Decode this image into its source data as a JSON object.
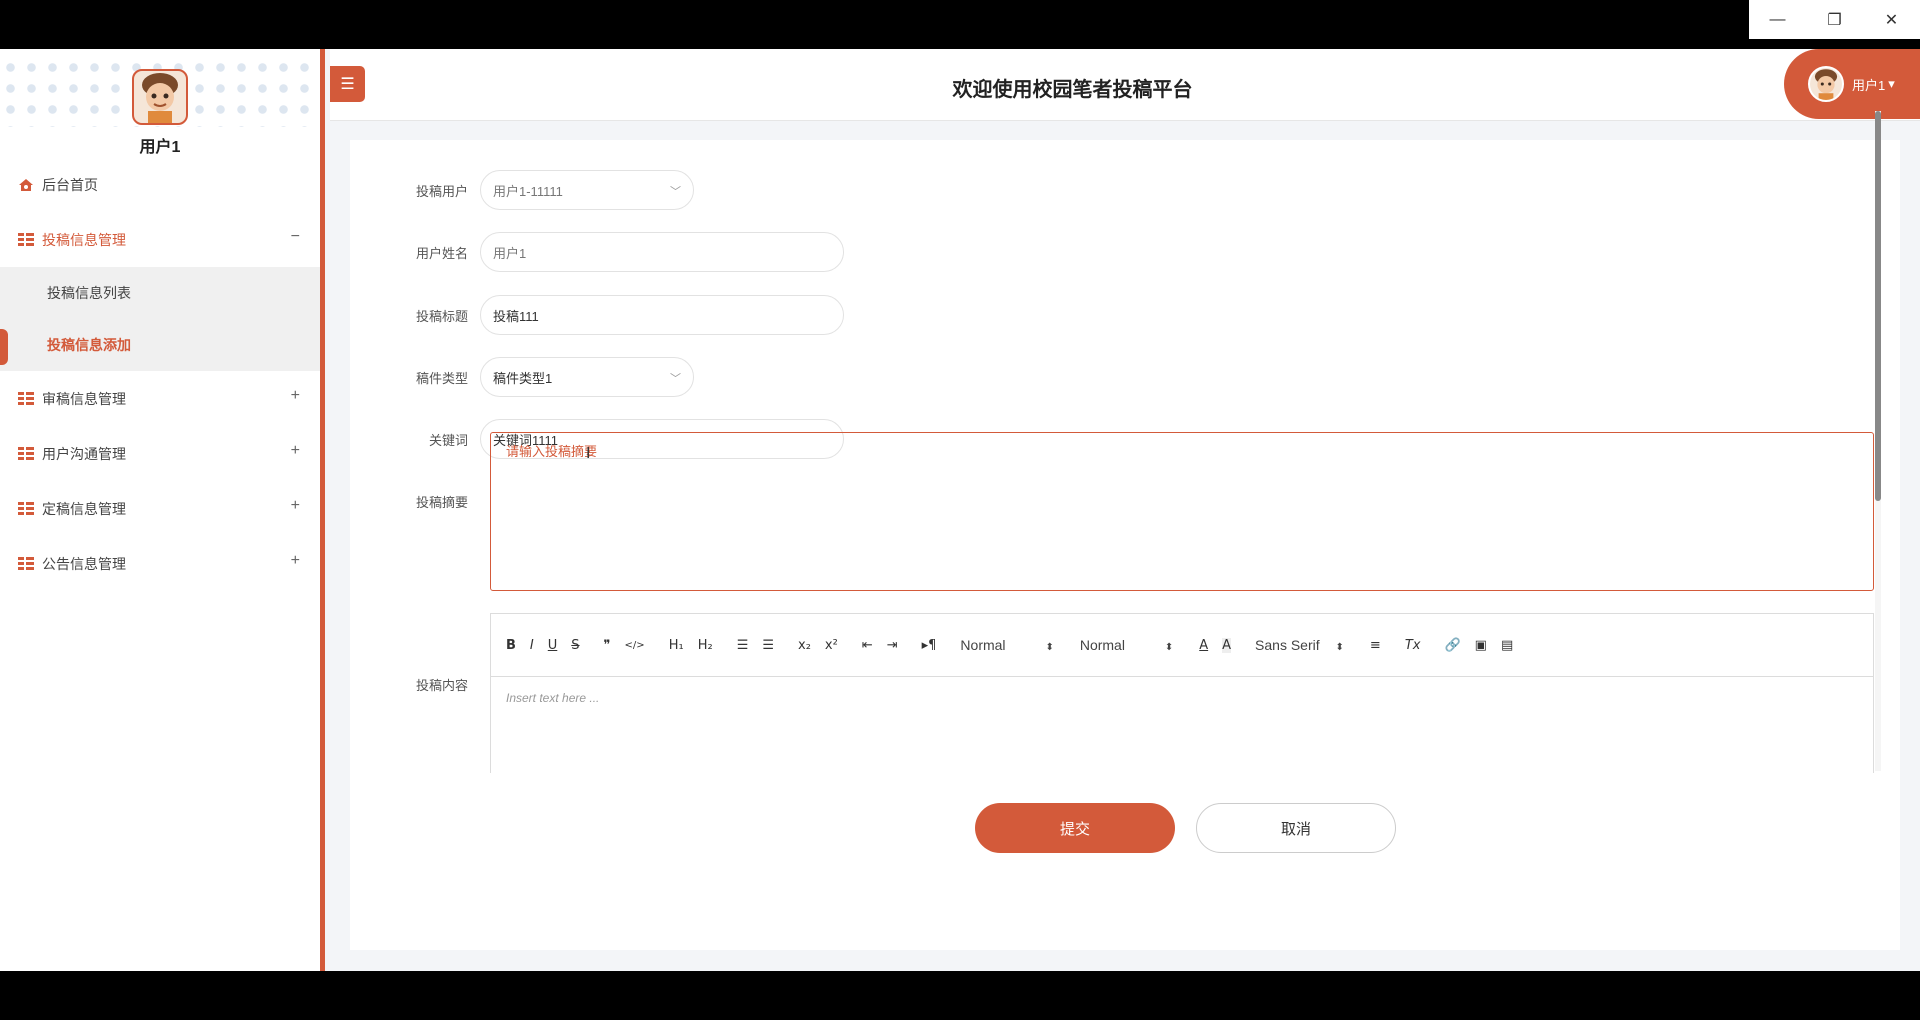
{
  "sidebar": {
    "username": "用户1",
    "items": [
      {
        "label": "后台首页"
      },
      {
        "label": "投稿信息管理",
        "toggle": "−"
      },
      {
        "label": "审稿信息管理",
        "toggle": "+"
      },
      {
        "label": "用户沟通管理",
        "toggle": "+"
      },
      {
        "label": "定稿信息管理",
        "toggle": "+"
      },
      {
        "label": "公告信息管理",
        "toggle": "+"
      }
    ],
    "submenu": [
      {
        "label": "投稿信息列表"
      },
      {
        "label": "投稿信息添加"
      }
    ]
  },
  "header": {
    "menu_icon": "☰",
    "title": "欢迎使用校园笔者投稿平台",
    "user": "用户1",
    "user_caret": "▾"
  },
  "form": {
    "fields": [
      {
        "label": "投稿用户",
        "value": "用户1-11111"
      },
      {
        "label": "用户姓名",
        "value": "用户1"
      },
      {
        "label": "投稿标题",
        "value": "投稿111"
      },
      {
        "label": "稿件类型",
        "value": "稿件类型1"
      },
      {
        "label": "关键词",
        "value": "关键词1111"
      }
    ],
    "abstract_label": "投稿摘要",
    "abstract_placeholder": "请输入投稿摘要",
    "content_label": "投稿内容",
    "editor_placeholder": "Insert text here ...",
    "toolbar": {
      "bold": "B",
      "italic": "I",
      "underline": "U",
      "strike": "S",
      "quote": "❞",
      "code": "</>",
      "h1": "H₁",
      "h2": "H₂",
      "ol": "☰",
      "ul": "☰",
      "sub": "x₂",
      "sup": "x²",
      "outdent": "⇤",
      "indent": "⇥",
      "rtl": "▸¶",
      "size1": "Normal",
      "size2": "Normal",
      "font": "Sans Serif",
      "align": "≡",
      "clean": "Tx",
      "link": "🔗",
      "image": "▣",
      "video": "▤"
    },
    "submit": "提交",
    "cancel": "取消"
  },
  "window": {
    "minimize": "—",
    "restore": "❐",
    "close": "✕"
  },
  "colors": {
    "accent": "#d35a3a"
  }
}
